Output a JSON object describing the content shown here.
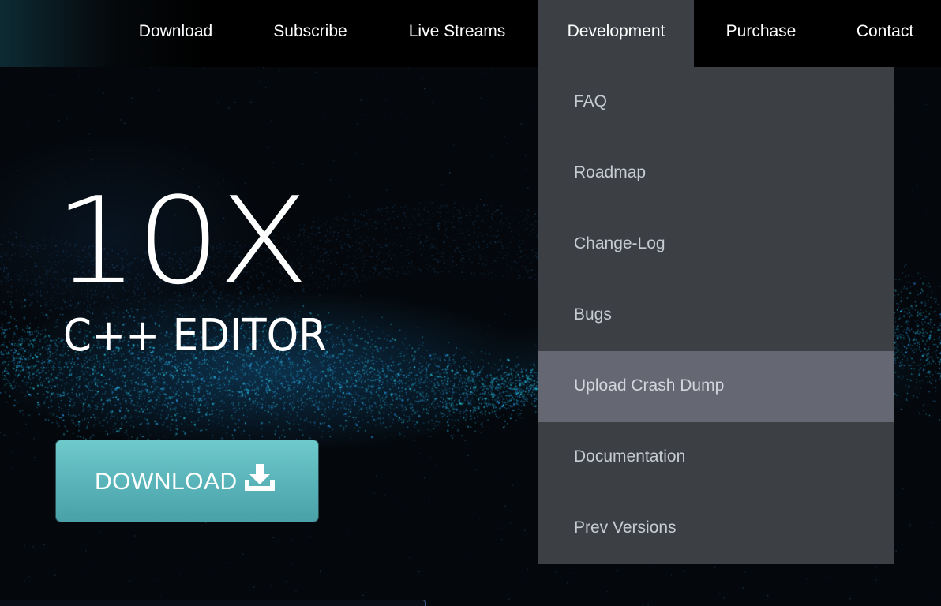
{
  "nav": {
    "items": [
      {
        "id": "download",
        "label": "Download"
      },
      {
        "id": "subscribe",
        "label": "Subscribe"
      },
      {
        "id": "live-streams",
        "label": "Live Streams"
      },
      {
        "id": "development",
        "label": "Development",
        "active": true
      },
      {
        "id": "purchase",
        "label": "Purchase"
      },
      {
        "id": "contact",
        "label": "Contact"
      }
    ]
  },
  "hero": {
    "title": "10X",
    "subtitle": "C++ EDITOR",
    "download_button": {
      "label": "DOWNLOAD",
      "icon": "download-icon"
    }
  },
  "dropdown": {
    "items": [
      {
        "label": "FAQ"
      },
      {
        "label": "Roadmap"
      },
      {
        "label": "Change-Log"
      },
      {
        "label": "Bugs"
      },
      {
        "label": "Upload Crash Dump",
        "hovered": true
      },
      {
        "label": "Documentation"
      },
      {
        "label": "Prev Versions"
      }
    ]
  },
  "colors": {
    "nav_background": "#000000",
    "nav_active_background": "#3c4045",
    "dropdown_background": "#3c4045",
    "dropdown_hover_background": "#656873",
    "dropdown_text": "#c7cbd3",
    "cta_teal": "#5fbcc0",
    "particle_blue": "#2a9fd8"
  }
}
